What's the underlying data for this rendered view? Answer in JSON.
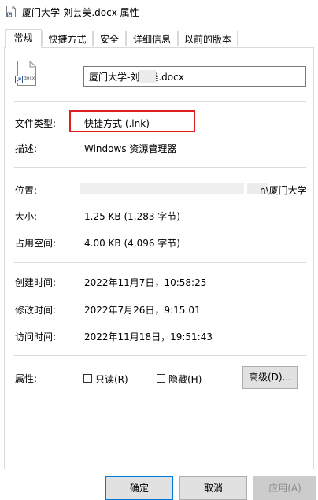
{
  "window": {
    "title": "厦门大学-刘芸美.docx 属性"
  },
  "tabs": [
    {
      "label": "常规"
    },
    {
      "label": "快捷方式"
    },
    {
      "label": "安全"
    },
    {
      "label": "详细信息"
    },
    {
      "label": "以前的版本"
    }
  ],
  "general": {
    "file_name": "厦门大学-刘芸美.docx",
    "file_icon_label": "docx",
    "rows": {
      "type_label": "文件类型:",
      "type_value": "快捷方式 (.lnk)",
      "desc_label": "描述:",
      "desc_value": "Windows 资源管理器",
      "location_label": "位置:",
      "location_value": "n\\厦门大学-",
      "size_label": "大小:",
      "size_value": "1.25 KB (1,283 字节)",
      "disk_label": "占用空间:",
      "disk_value": "4.00 KB (4,096 字节)",
      "created_label": "创建时间:",
      "created_value": "2022年11月7日，10:58:25",
      "modified_label": "修改时间:",
      "modified_value": "2022年7月26日，9:15:01",
      "accessed_label": "访问时间:",
      "accessed_value": "2022年11月18日，19:51:43",
      "attrs_label": "属性:"
    },
    "attributes": {
      "readonly_label": "只读(R)",
      "readonly_checked": false,
      "hidden_label": "隐藏(H)",
      "hidden_checked": false,
      "advanced_label": "高级(D)..."
    }
  },
  "buttons": {
    "ok": "确定",
    "cancel": "取消",
    "apply": "应用(A)"
  },
  "colors": {
    "highlight": "#e02020",
    "default_button_border": "#0078d7"
  }
}
